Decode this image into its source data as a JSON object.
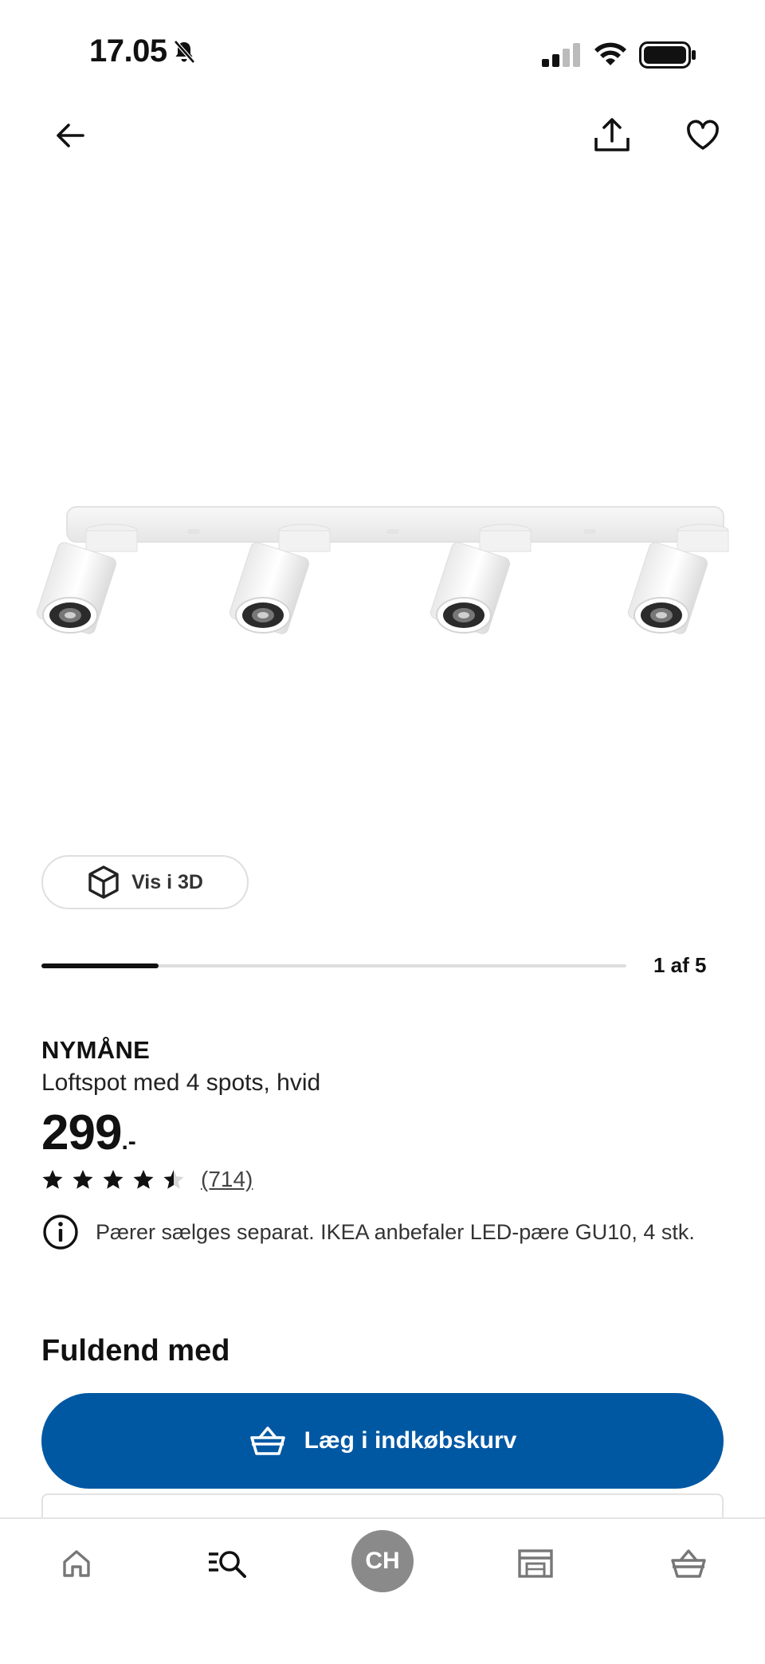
{
  "status_bar": {
    "time": "17.05"
  },
  "gallery": {
    "view_3d_label": "Vis i 3D",
    "pager": "1 af 5",
    "progress": 0.2
  },
  "product": {
    "brand": "NYMÅNE",
    "description": "Loftspot med 4 spots, hvid",
    "price": "299",
    "price_suffix": ".-",
    "rating": 4.5,
    "review_count": "(714)",
    "info_text": "Pærer sælges separat. IKEA anbefaler LED-pære GU10, 4 stk."
  },
  "section_title": "Fuldend med",
  "add_to_cart_label": "Læg i indkøbskurv",
  "tabbar": {
    "profile_initials": "CH"
  },
  "colors": {
    "primary": "#0058a3",
    "avatar": "#8a8a8a"
  }
}
